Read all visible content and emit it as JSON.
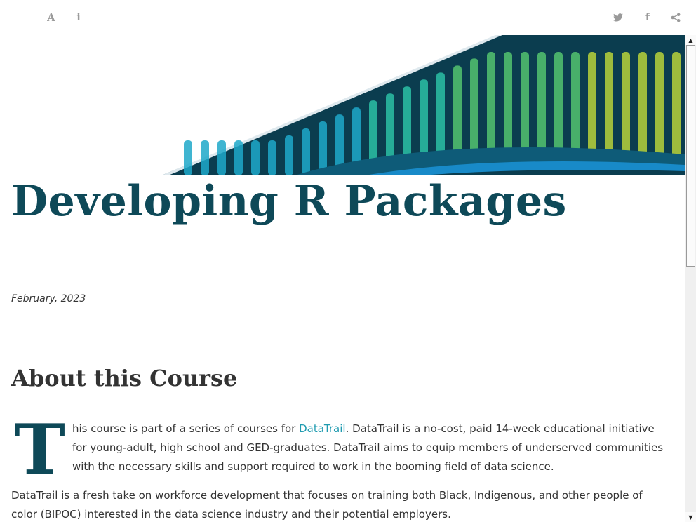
{
  "toolbar": {
    "font_icon": "A",
    "info_icon": "i",
    "facebook_icon": "f",
    "icons": [
      "font-settings-icon",
      "info-icon",
      "twitter-icon",
      "facebook-icon",
      "share-icon"
    ]
  },
  "banner": {
    "colors": [
      "#0b3d4f",
      "#1fa8c9",
      "#2bbfa4",
      "#54c36e",
      "#b9d23a"
    ]
  },
  "page": {
    "title": "Developing R Packages",
    "date": "February, 2023"
  },
  "section": {
    "heading": "About this Course",
    "dropcap": "T",
    "para1_start": "his course is part of a series of courses for ",
    "link_text": "DataTrail",
    "para1_end": ". DataTrail is a no-cost, paid 14-week educational initiative for young-adult, high school and GED-graduates. DataTrail aims to equip members of underserved communities with the necessary skills and support required to work in the booming field of data science.",
    "para2": "DataTrail is a fresh take on workforce development that focuses on training both Black, Indigenous, and other people of color (BIPOC) interested in the data science industry and their potential employers."
  },
  "scrollbar": {
    "up": "▲",
    "down": "▼"
  },
  "colors": {
    "title": "#0e4958",
    "link": "#1f9bb0",
    "toolbar_icon": "#9a9a9a"
  }
}
